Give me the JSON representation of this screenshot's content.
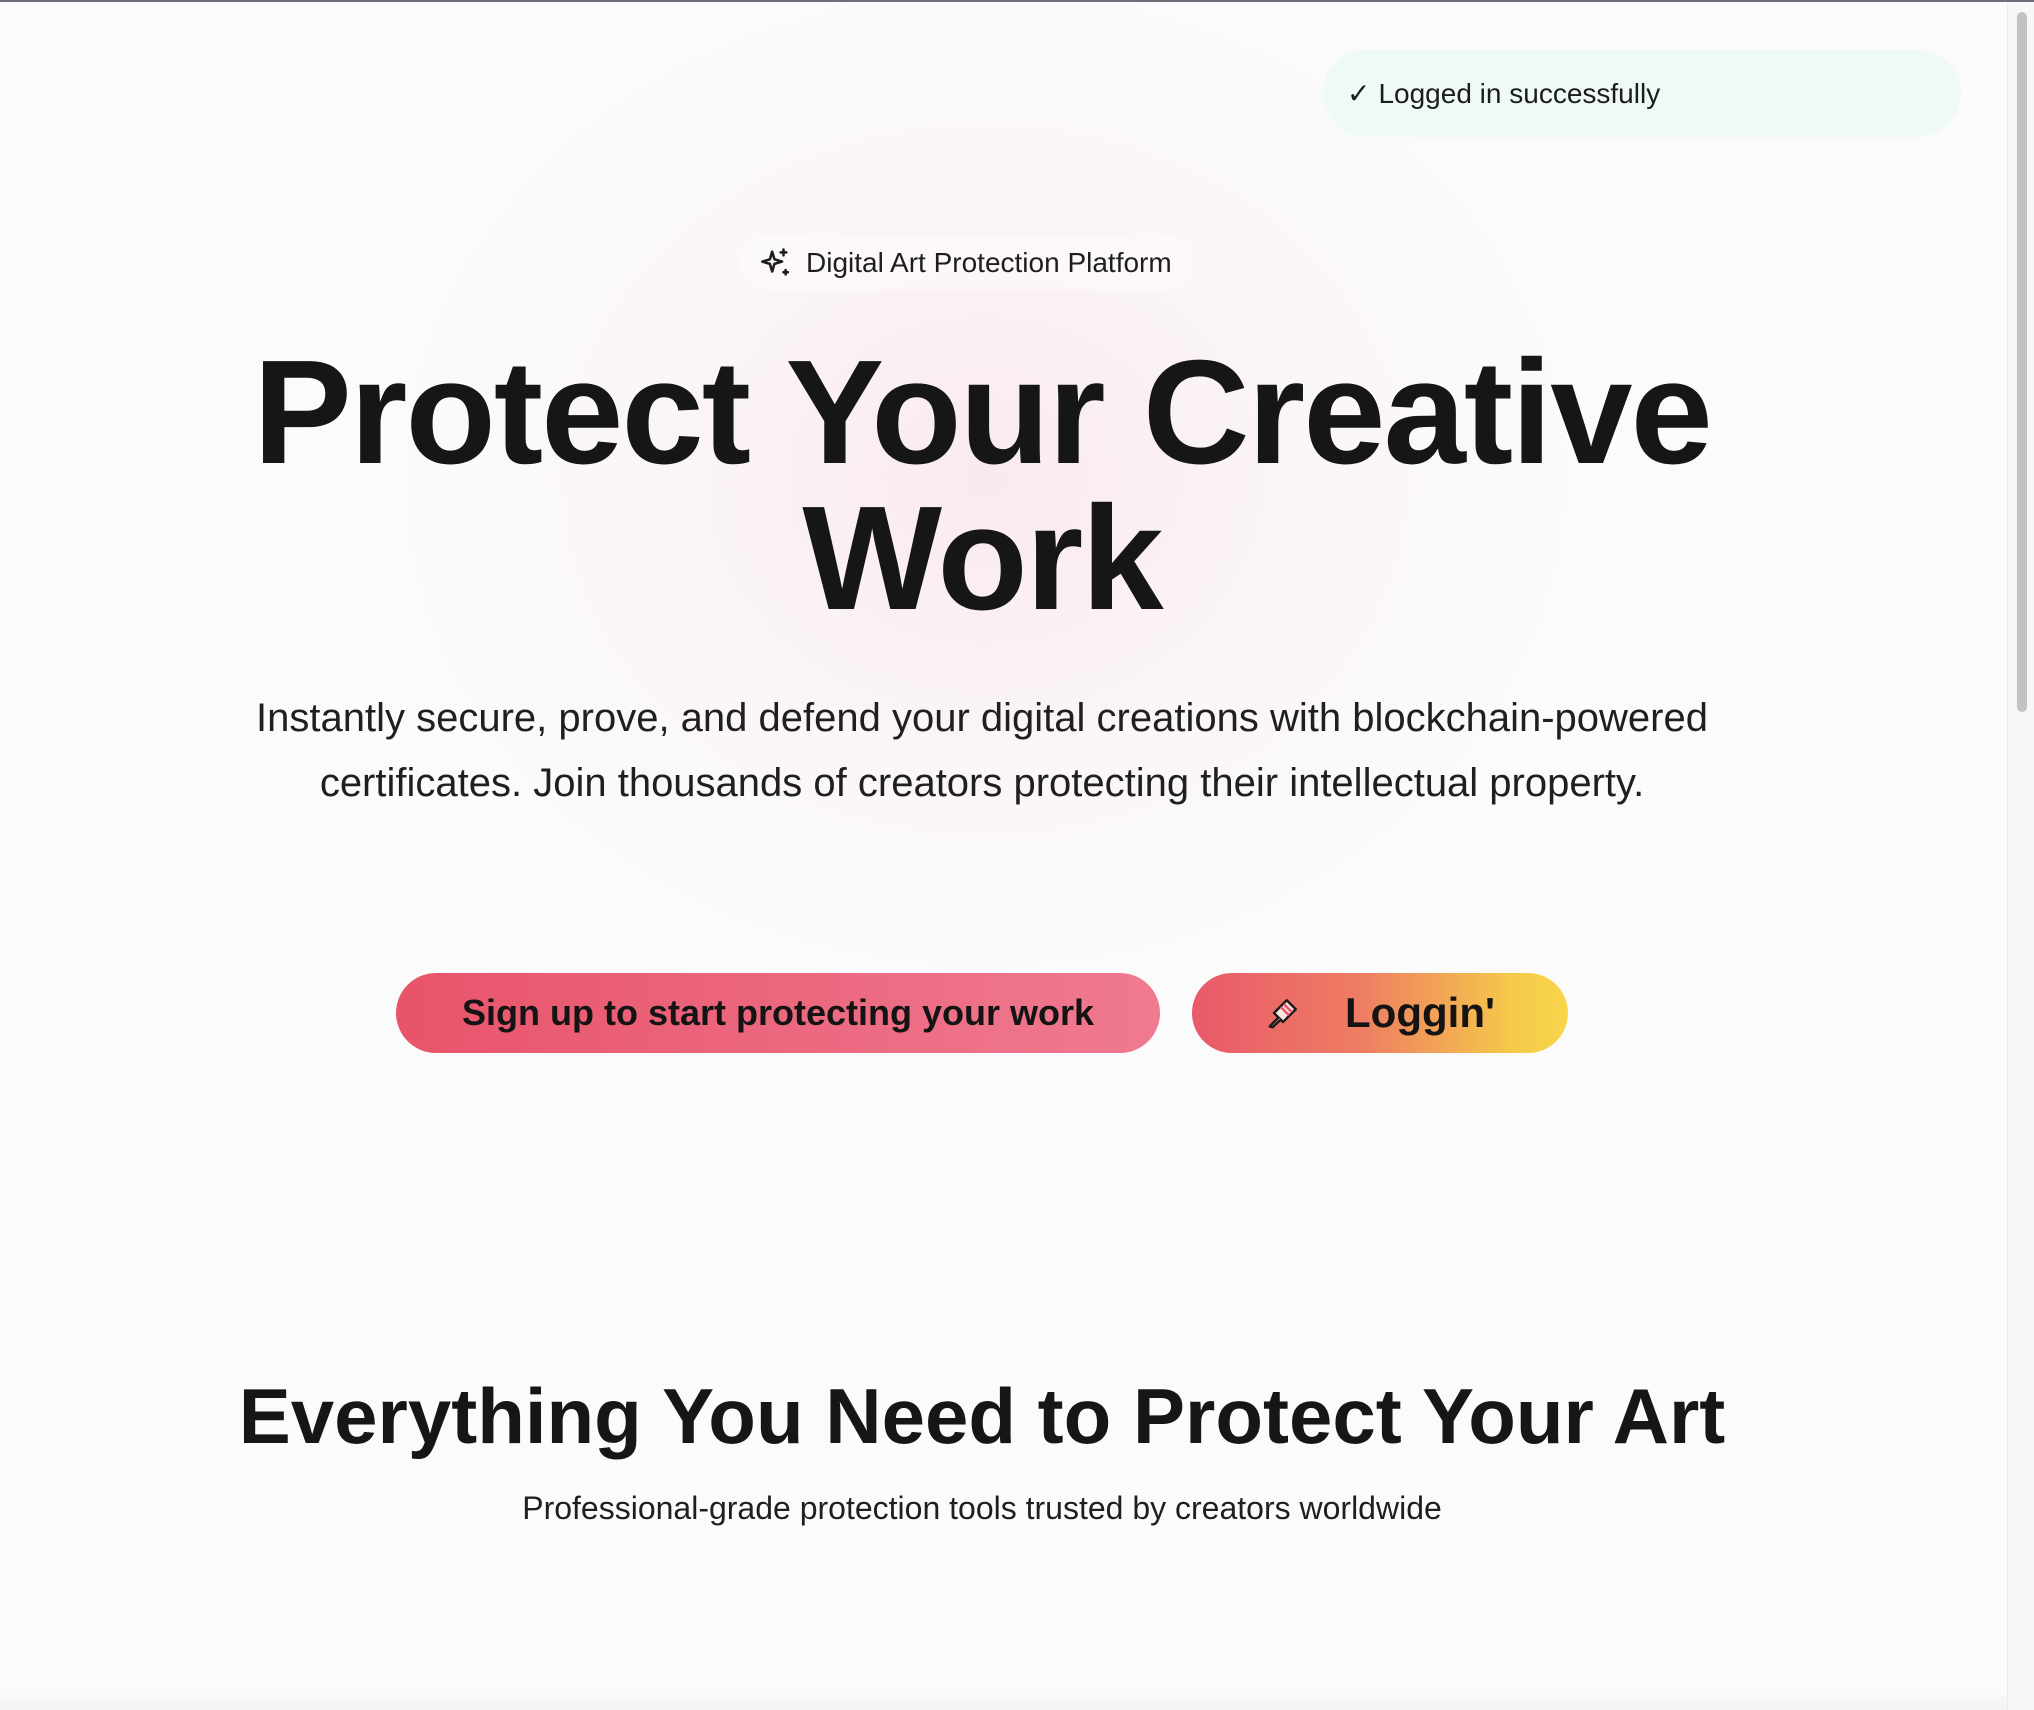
{
  "toast": {
    "icon": "check-icon",
    "check": "✓",
    "message": "Logged in successfully",
    "color": "#eefaf3"
  },
  "hero": {
    "badge_icon": "sparkle-icon",
    "badge": "Digital Art Protection Platform",
    "title_line1": "Protect Your Creative",
    "title_line2": "Work",
    "subtitle": "Instantly secure, prove, and defend your digital creations with blockchain-powered certificates. Join thousands of creators protecting their intellectual property."
  },
  "buttons": {
    "signup_label": "Sign up to start protecting your work",
    "login_icon": "paintbrush-icon",
    "login_label": "Loggin'"
  },
  "features": {
    "title": "Everything You Need to Protect Your Art",
    "subtitle": "Professional-grade protection tools trusted by creators worldwide"
  },
  "colors": {
    "accent_pink": "#e8546a",
    "accent_yellow": "#f7d64a",
    "text": "#171717",
    "background": "#fbfbfc"
  }
}
